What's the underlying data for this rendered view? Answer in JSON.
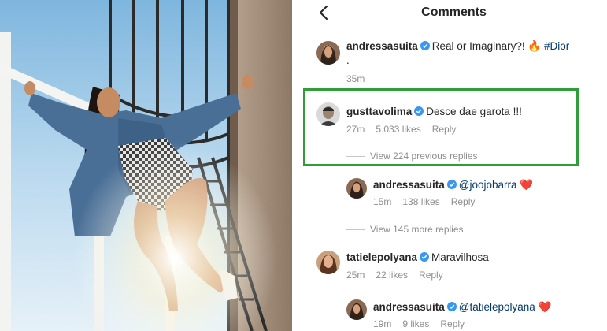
{
  "header": {
    "title": "Comments"
  },
  "comments": [
    {
      "username": "andressasuita",
      "verified": true,
      "text": "Real or Imaginary?! ",
      "emoji": "🔥",
      "hashtag": "#Dior",
      "trailing": ".",
      "time": "35m"
    },
    {
      "username": "gusttavolima",
      "verified": true,
      "text": "Desce dae garota !!!",
      "time": "27m",
      "likes": "5.033 likes",
      "reply_label": "Reply",
      "view_replies": "View 224 previous replies"
    },
    {
      "username": "andressasuita",
      "verified": true,
      "mention": "@joojobarra",
      "emoji": "❤️",
      "time": "15m",
      "likes": "138 likes",
      "reply_label": "Reply",
      "view_replies": "View 145 more replies"
    },
    {
      "username": "tatielepolyana",
      "verified": true,
      "text": "Maravilhosa",
      "time": "25m",
      "likes": "22 likes",
      "reply_label": "Reply"
    },
    {
      "username": "andressasuita",
      "verified": true,
      "mention": "@tatielepolyana",
      "emoji": "❤️",
      "time": "19m",
      "likes": "9 likes",
      "reply_label": "Reply"
    }
  ],
  "colors": {
    "highlight": "#2f9e3a",
    "verified": "#3897f0",
    "mention": "#00376b",
    "muted": "#8e8e8e"
  },
  "icons": {
    "back": "chevron-left-icon",
    "verified": "verified-badge-icon"
  }
}
